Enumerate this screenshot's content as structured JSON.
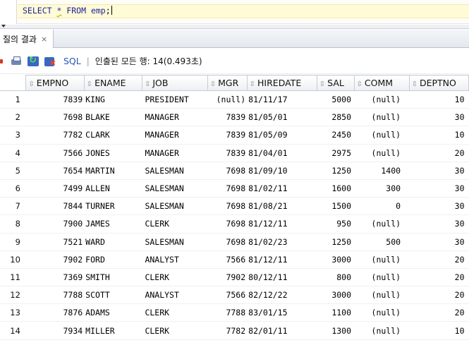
{
  "editor": {
    "query_prefix": "SELECT ",
    "query_star": "*",
    "query_suffix": " FROM emp",
    "query_semi": ";"
  },
  "results_tab": {
    "label": "질의 결과",
    "close_label": "×"
  },
  "toolbar": {
    "icons": [
      "pin-icon",
      "print-icon",
      "refresh-icon",
      "clear-results-icon"
    ],
    "sql_label": "SQL",
    "separator": "|",
    "status": "인출된 모든 행: 14(0.493초)"
  },
  "grid": {
    "sort_icon": "⇳",
    "columns": [
      "EMPNO",
      "ENAME",
      "JOB",
      "MGR",
      "HIREDATE",
      "SAL",
      "COMM",
      "DEPTNO"
    ],
    "rows": [
      [
        "1",
        "7839",
        "KING",
        "PRESIDENT",
        "(null)",
        "81/11/17",
        "5000",
        "(null)",
        "10"
      ],
      [
        "2",
        "7698",
        "BLAKE",
        "MANAGER",
        "7839",
        "81/05/01",
        "2850",
        "(null)",
        "30"
      ],
      [
        "3",
        "7782",
        "CLARK",
        "MANAGER",
        "7839",
        "81/05/09",
        "2450",
        "(null)",
        "10"
      ],
      [
        "4",
        "7566",
        "JONES",
        "MANAGER",
        "7839",
        "81/04/01",
        "2975",
        "(null)",
        "20"
      ],
      [
        "5",
        "7654",
        "MARTIN",
        "SALESMAN",
        "7698",
        "81/09/10",
        "1250",
        "1400",
        "30"
      ],
      [
        "6",
        "7499",
        "ALLEN",
        "SALESMAN",
        "7698",
        "81/02/11",
        "1600",
        "300",
        "30"
      ],
      [
        "7",
        "7844",
        "TURNER",
        "SALESMAN",
        "7698",
        "81/08/21",
        "1500",
        "0",
        "30"
      ],
      [
        "8",
        "7900",
        "JAMES",
        "CLERK",
        "7698",
        "81/12/11",
        "950",
        "(null)",
        "30"
      ],
      [
        "9",
        "7521",
        "WARD",
        "SALESMAN",
        "7698",
        "81/02/23",
        "1250",
        "500",
        "30"
      ],
      [
        "10",
        "7902",
        "FORD",
        "ANALYST",
        "7566",
        "81/12/11",
        "3000",
        "(null)",
        "20"
      ],
      [
        "11",
        "7369",
        "SMITH",
        "CLERK",
        "7902",
        "80/12/11",
        "800",
        "(null)",
        "20"
      ],
      [
        "12",
        "7788",
        "SCOTT",
        "ANALYST",
        "7566",
        "82/12/22",
        "3000",
        "(null)",
        "20"
      ],
      [
        "13",
        "7876",
        "ADAMS",
        "CLERK",
        "7788",
        "83/01/15",
        "1100",
        "(null)",
        "20"
      ],
      [
        "14",
        "7934",
        "MILLER",
        "CLERK",
        "7782",
        "82/01/11",
        "1300",
        "(null)",
        "10"
      ]
    ]
  }
}
